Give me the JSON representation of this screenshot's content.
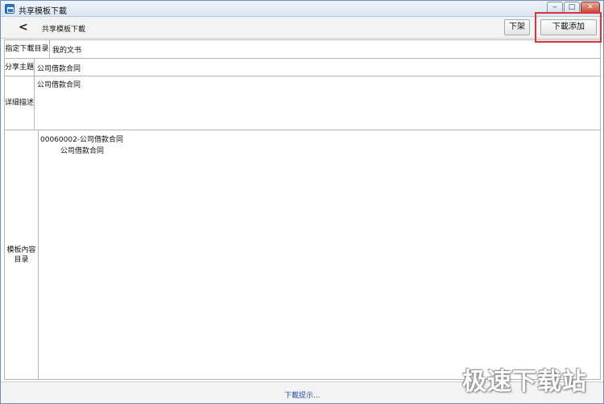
{
  "window": {
    "title": "共享模板下載"
  },
  "toolbar": {
    "back_label": "<",
    "title": "共享模板下載",
    "unlist_label": "下架",
    "download_add_label": "下載添加"
  },
  "form": {
    "dir_label": "指定下載目录",
    "dir_value": "我的文书",
    "topic_label": "分享主題",
    "topic_value": "公司借款合同",
    "desc_label": "详細描述",
    "desc_value": "公司借款合同",
    "content_label": "模板內容目录",
    "tree": {
      "root": "00060002-公司借款合同",
      "child": "公司借款合同"
    }
  },
  "footer": {
    "hint_label": "下載提示..."
  },
  "watermark": {
    "text": "极速下载站"
  },
  "colors": {
    "highlight_border": "#d9343a",
    "link": "#2a4fb0"
  }
}
